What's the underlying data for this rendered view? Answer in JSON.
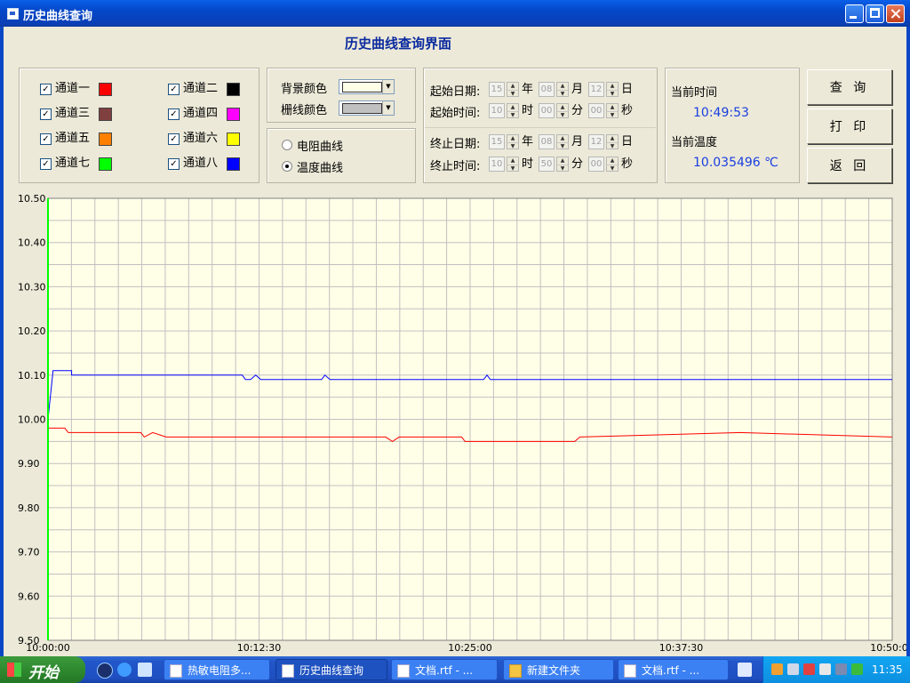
{
  "window": {
    "title": "历史曲线查询"
  },
  "heading": "历史曲线查询界面",
  "channels": [
    {
      "label": "通道一",
      "checked": true,
      "color": "#ff0000"
    },
    {
      "label": "通道二",
      "checked": true,
      "color": "#000000"
    },
    {
      "label": "通道三",
      "checked": true,
      "color": "#804040"
    },
    {
      "label": "通道四",
      "checked": true,
      "color": "#ff00ff"
    },
    {
      "label": "通道五",
      "checked": true,
      "color": "#ff8000"
    },
    {
      "label": "通道六",
      "checked": true,
      "color": "#ffff00"
    },
    {
      "label": "通道七",
      "checked": true,
      "color": "#00ff00"
    },
    {
      "label": "通道八",
      "checked": true,
      "color": "#0000ff"
    }
  ],
  "colors": {
    "bg_label": "背景颜色",
    "bg_color": "#ffffe8",
    "grid_label": "栅线颜色",
    "grid_color": "#c0c0c0"
  },
  "curve_type": {
    "resistance": "电阻曲线",
    "temperature": "温度曲线",
    "selected": "temperature"
  },
  "start": {
    "date_label": "起始日期:",
    "time_label": "起始时间:",
    "year": "15",
    "month": "08",
    "day": "12",
    "hour": "10",
    "minute": "00",
    "second": "00"
  },
  "end": {
    "date_label": "终止日期:",
    "time_label": "终止时间:",
    "year": "15",
    "month": "08",
    "day": "12",
    "hour": "10",
    "minute": "50",
    "second": "00"
  },
  "units": {
    "year": "年",
    "month": "月",
    "day": "日",
    "hour": "时",
    "minute": "分",
    "second": "秒"
  },
  "status": {
    "time_label": "当前时间",
    "time_value": "10:49:53",
    "temp_label": "当前温度",
    "temp_value": "10.035496 ℃"
  },
  "buttons": {
    "query": "查 询",
    "print": "打 印",
    "back": "返 回"
  },
  "chart_data": {
    "type": "line",
    "ylim": [
      9.5,
      10.5
    ],
    "y_ticks": [
      "10.50",
      "10.40",
      "10.30",
      "10.20",
      "10.10",
      "10.00",
      "9.90",
      "9.80",
      "9.70",
      "9.60",
      "9.50"
    ],
    "x_ticks": [
      "10:00:00",
      "10:12:30",
      "10:25:00",
      "10:37:30",
      "10:50:00"
    ],
    "x_range_minutes": [
      0,
      50
    ],
    "background": "#ffffe8",
    "grid": true,
    "series": [
      {
        "color": "#0000ff",
        "x": [
          0,
          0.3,
          1.4,
          1.4,
          11.5,
          11.7,
          12.0,
          12.3,
          12.6,
          16.2,
          16.4,
          16.7,
          25.8,
          26.0,
          26.2,
          50
        ],
        "y": [
          10.0,
          10.11,
          10.11,
          10.1,
          10.1,
          10.09,
          10.09,
          10.1,
          10.09,
          10.09,
          10.1,
          10.09,
          10.09,
          10.1,
          10.09,
          10.09
        ]
      },
      {
        "color": "#ff0000",
        "x": [
          0,
          1.0,
          1.2,
          5.5,
          5.7,
          6.2,
          7.0,
          7.3,
          20.0,
          20.4,
          20.8,
          24.5,
          24.7,
          31.2,
          31.5,
          41.0,
          50
        ],
        "y": [
          9.98,
          9.98,
          9.97,
          9.97,
          9.96,
          9.97,
          9.96,
          9.96,
          9.96,
          9.95,
          9.96,
          9.96,
          9.95,
          9.95,
          9.96,
          9.97,
          9.96
        ]
      },
      {
        "color": "#00ff00",
        "x": [
          0,
          0
        ],
        "y": [
          9.5,
          10.5
        ]
      }
    ]
  },
  "taskbar": {
    "start_label": "开始",
    "tasks": [
      "热敏电阻多...",
      "历史曲线查询",
      "文档.rtf - ...",
      "新建文件夹",
      "文档.rtf - ..."
    ],
    "clock": "11:35"
  }
}
